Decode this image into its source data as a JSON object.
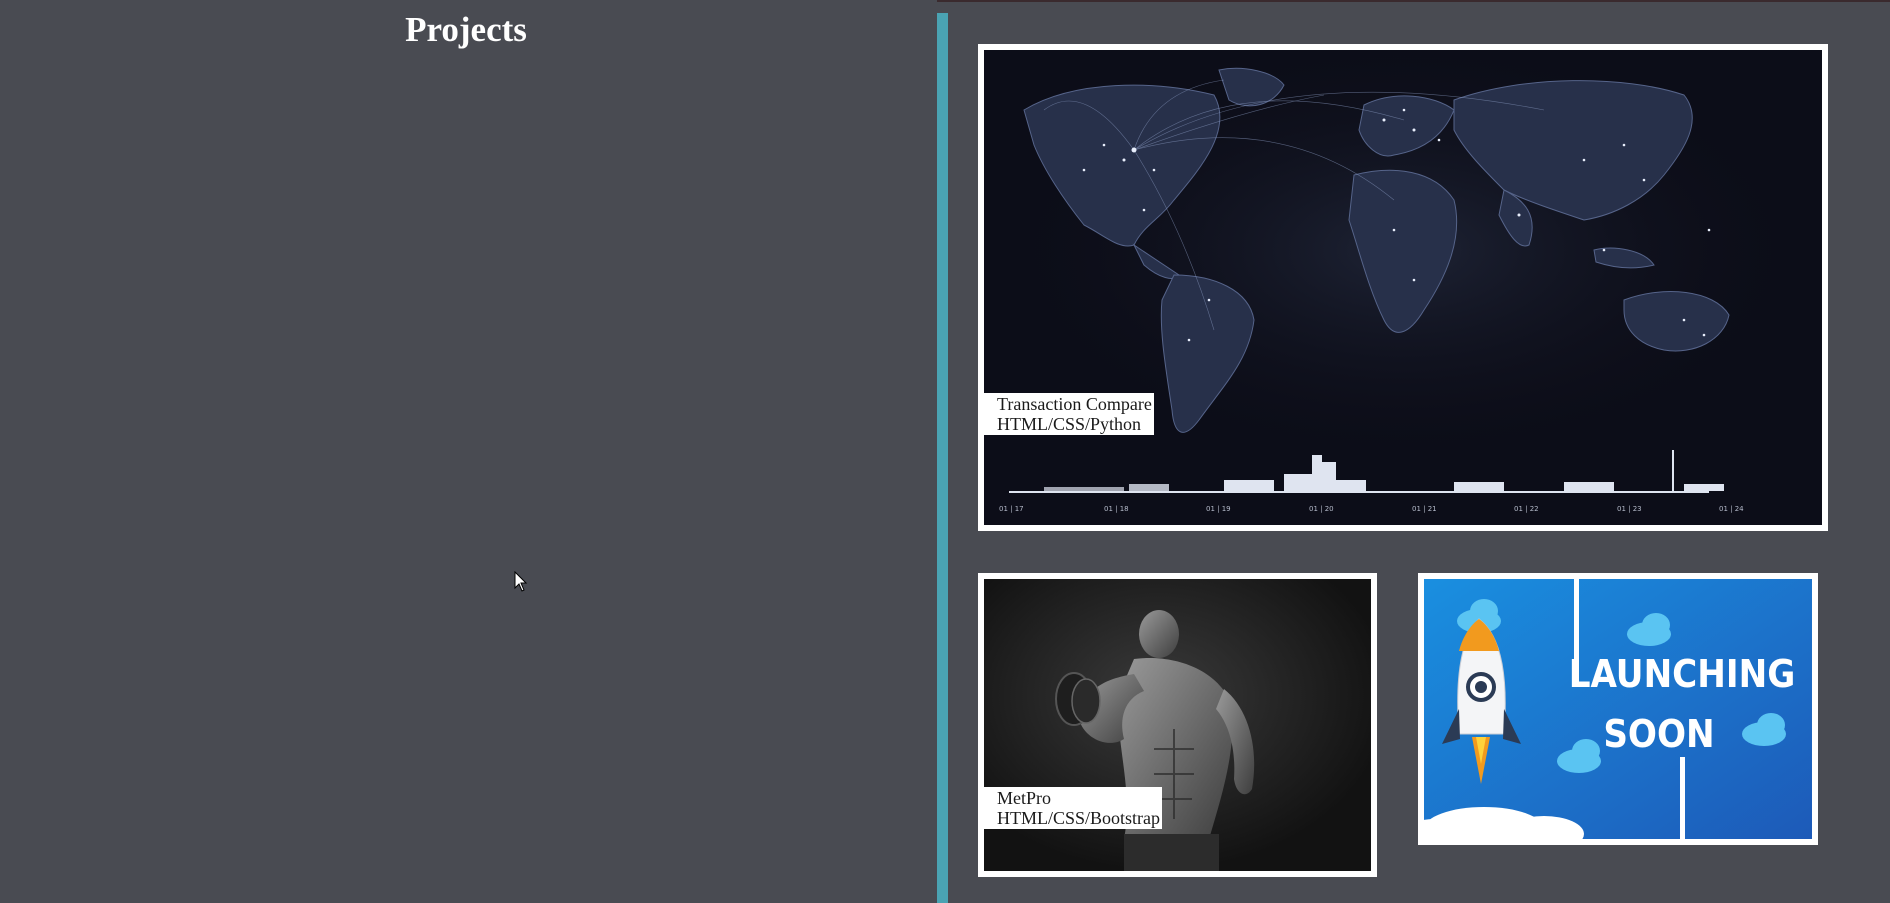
{
  "header": {
    "title": "Projects"
  },
  "projects": [
    {
      "title": "Transaction Compare",
      "stack": "HTML/CSS/Python"
    },
    {
      "title": "MetPro",
      "stack": "HTML/CSS/Bootstrap"
    }
  ],
  "launch_card": {
    "line1": "LAUNCHING",
    "line2": "SOON"
  },
  "timeline_labels": [
    "01 | 17",
    "01 | 18",
    "01 | 19",
    "01 | 20",
    "01 | 21",
    "01 | 22",
    "01 | 23",
    "01 | 24"
  ],
  "colors": {
    "background": "#494b52",
    "accent": "#4aa3b3",
    "card_border": "#ffffff"
  }
}
